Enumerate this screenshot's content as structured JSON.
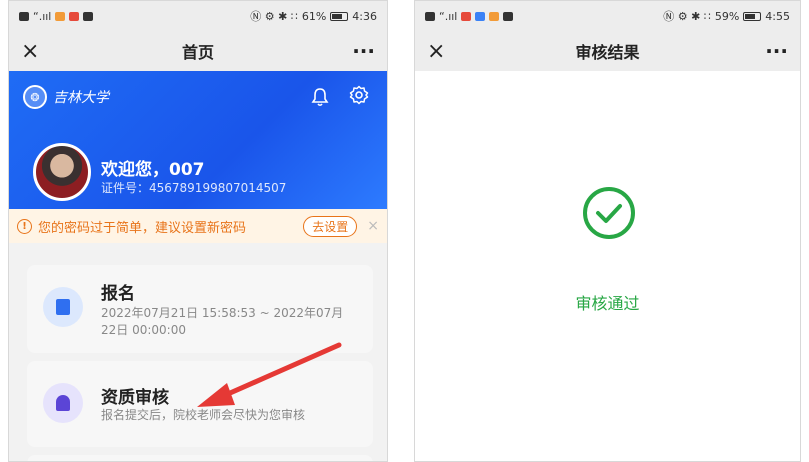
{
  "left_screen": {
    "status": {
      "signal": "“.ııl",
      "right_icons": "Ⓝ ⚙ ✱ ∷",
      "battery": "61%",
      "time": "4:36"
    },
    "navbar": {
      "close_icon": "×",
      "title": "首页",
      "more_icon": "···"
    },
    "hero": {
      "logo_text": "吉林大学",
      "welcome": "欢迎您，007",
      "id_line": "证件号：456789199807014507"
    },
    "notice": {
      "text": "您的密码过于简单，建议设置新密码",
      "button": "去设置",
      "close": "×"
    },
    "cards": [
      {
        "title": "报名",
        "desc": "2022年07月21日 15:58:53 ~ 2022年07月\n22日 00:00:00"
      },
      {
        "title": "资质审核",
        "desc": "报名提交后，院校老师会尽快为您审核"
      }
    ]
  },
  "right_screen": {
    "status": {
      "signal": "“.ııl",
      "right_icons": "Ⓝ ⚙ ✱ ∷",
      "battery": "59%",
      "time": "4:55"
    },
    "navbar": {
      "close_icon": "×",
      "title": "审核结果",
      "more_icon": "···"
    },
    "result_text": "审核通过"
  },
  "colors": {
    "hero_blue": "#1a55ea",
    "notice_orange": "#e8741a",
    "success_green": "#28a745",
    "annotation_red": "#e53935"
  },
  "icons": [
    "close-icon",
    "more-icon",
    "bell-icon",
    "gear-icon",
    "warning-icon",
    "document-icon",
    "stamp-icon",
    "check-circle-icon",
    "red-annotation-arrow"
  ]
}
